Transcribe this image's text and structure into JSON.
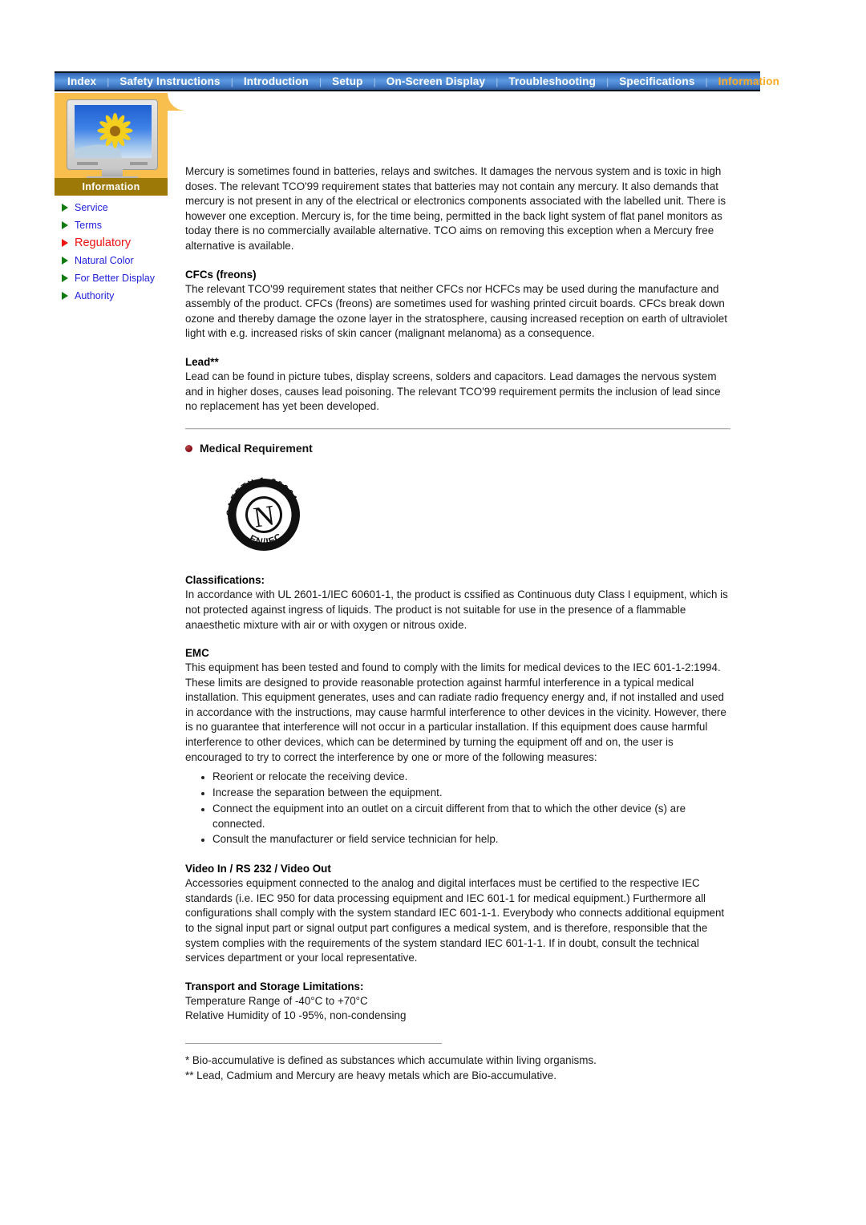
{
  "nav": {
    "separator": "|",
    "items": [
      {
        "label": "Index",
        "active": false
      },
      {
        "label": "Safety Instructions",
        "active": false
      },
      {
        "label": "Introduction",
        "active": false
      },
      {
        "label": "Setup",
        "active": false
      },
      {
        "label": "On-Screen Display",
        "active": false
      },
      {
        "label": "Troubleshooting",
        "active": false
      },
      {
        "label": "Specifications",
        "active": false
      },
      {
        "label": "Information",
        "active": true
      }
    ]
  },
  "sidebar": {
    "caption": "Information",
    "thumbnail_icon": "monitor-sunflower-icon",
    "items": [
      {
        "label": "Service",
        "active": false
      },
      {
        "label": "Terms",
        "active": false
      },
      {
        "label": "Regulatory",
        "active": true
      },
      {
        "label": "Natural Color",
        "active": false
      },
      {
        "label": "For Better Display",
        "active": false
      },
      {
        "label": "Authority",
        "active": false
      }
    ],
    "colors": {
      "panel": "#f8bf4e",
      "band": "#9d7908",
      "link": "#2222dd",
      "active": "#ee1111",
      "arrow": "#117a11"
    }
  },
  "content": {
    "mercury_paragraph": "Mercury is sometimes found in batteries, relays and switches. It damages the nervous system and is toxic in high doses. The relevant TCO'99 requirement states that batteries may not contain any mercury. It also demands that mercury is not present in any of the electrical or electronics components associated with the labelled unit. There is however one exception. Mercury is, for the time being, permitted in the back light system of flat panel monitors as today there is no commercially available alternative. TCO aims on removing this exception when a Mercury free alternative is available.",
    "cfcs_heading": "CFCs (freons)",
    "cfcs_paragraph": "The relevant TCO'99 requirement states that neither CFCs nor HCFCs may be used during the manufacture and assembly of the product. CFCs (freons) are sometimes used for washing printed circuit boards. CFCs break down ozone and thereby damage the ozone layer in the stratosphere, causing increased reception on earth of ultraviolet light with e.g. increased risks of skin cancer (malignant melanoma) as a consequence.",
    "lead_heading": "Lead**",
    "lead_paragraph": "Lead can be found in picture tubes, display screens, solders and capacitors. Lead damages the nervous system and in higher doses, causes lead poisoning. The relevant TCO'99 requirement permits the inclusion of lead since no replacement has yet been developed.",
    "medical_section_title": "Medical Requirement",
    "seal": {
      "icon": "safety-certification-seal-icon",
      "center_letter": "N",
      "ring_top_text": "SAFETY 1-60901",
      "ring_bottom_text": "EN/IEC"
    },
    "classifications_heading": "Classifications:",
    "classifications_paragraph": "In accordance with UL 2601-1/IEC 60601-1, the product is cssified as Continuous duty Class I equipment, which is not protected against ingress of liquids. The product is not suitable for use in the presence of a flammable anaesthetic mixture with air or with oxygen or nitrous oxide.",
    "emc_heading": "EMC",
    "emc_paragraph": "This equipment has been tested and found to comply with the limits for medical devices to the IEC 601-1-2:1994. These limits are designed to provide reasonable protection against harmful interference in a typical medical installation. This equipment generates, uses and can radiate radio frequency energy and, if not installed and used in accordance with the instructions, may cause harmful interference to other devices in the vicinity. However, there is no guarantee that interference will not occur in a particular installation. If this equipment does cause harmful interference to other devices, which can be determined by turning the equipment off and on, the user is encouraged to try to correct the interference by one or more of the following measures:",
    "measures": [
      "Reorient or relocate the receiving device.",
      "Increase the separation between the equipment.",
      "Connect the equipment into an outlet on a circuit different from that to which the other device (s) are connected.",
      "Consult the manufacturer or field service technician for help."
    ],
    "video_heading": "Video In / RS 232 / Video Out",
    "video_paragraph": "Accessories equipment connected to the analog and digital interfaces must be certified to the respective IEC standards (i.e. IEC 950 for data processing equipment and IEC 601-1 for medical equipment.) Furthermore all configurations shall comply with the system standard IEC 601-1-1. Everybody who connects additional equipment to the signal input part or signal output part configures a medical system, and is therefore, responsible that the system complies with the requirements of the system standard IEC 601-1-1. If in doubt, consult the technical services department or your local representative.",
    "transport_heading": "Transport and Storage Limitations:",
    "transport_line1": "Temperature Range of -40°C to +70°C",
    "transport_line2": "Relative Humidity of 10 -95%, non-condensing",
    "footnote_1": "* Bio-accumulative is defined as substances which accumulate within living organisms.",
    "footnote_2": "** Lead, Cadmium and Mercury are heavy metals which are Bio-accumulative."
  }
}
